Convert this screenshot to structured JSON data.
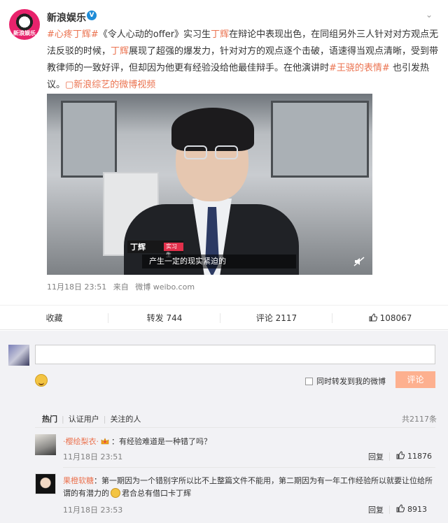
{
  "post": {
    "author": "新浪娱乐",
    "verified_mark": "V",
    "avatar_label": "新浪娱乐",
    "more_symbol": "⌄",
    "text_segments": [
      {
        "t": "#心疼丁辉#",
        "link": true
      },
      {
        "t": "《令人心动的offer》实习生",
        "link": false
      },
      {
        "t": "丁辉",
        "link": true
      },
      {
        "t": "在辩论中表现出色，在同组另外三人针对对方观点无法反驳的时候，",
        "link": false
      },
      {
        "t": "丁辉",
        "link": true
      },
      {
        "t": "展现了超强的爆发力，针对对方的观点逐个击破，语速得当观点清晰，受到带教律师的一致好评，但却因为他更有经验没给他最佳辩手。在他演讲时",
        "link": false
      },
      {
        "t": "#王骁的表情#",
        "link": true
      },
      {
        "t": " 也引发热议。",
        "link": false
      },
      {
        "t": "▢新浪综艺的微博视频",
        "link": true
      }
    ],
    "video": {
      "name_caption": "丁辉",
      "role_caption": "实习生",
      "subtitle": "产生一定的现实紧迫的"
    },
    "meta": {
      "time": "11月18日 23:51",
      "source_prefix": "来自",
      "source": "微博 weibo.com"
    }
  },
  "actions": {
    "favorite": "收藏",
    "repost": "转发 744",
    "comment": "评论 2117",
    "like": "108067"
  },
  "compose": {
    "input_placeholder": "",
    "forward_label": "同时转发到我的微博",
    "submit_label": "评论"
  },
  "comment_tabs": {
    "items": [
      "热门",
      "认证用户",
      "关注的人"
    ],
    "total": "共2117条"
  },
  "comments": [
    {
      "user": "·樱绘梨衣·",
      "text": "：有经验难道是一种错了吗？",
      "time": "11月18日 23:51",
      "reply": "回复",
      "likes": "11876"
    },
    {
      "user": "果橙软糖",
      "text_a": "：第一期因为一个错别字所以比不上整篇文件不能用，第二期因为有一年工作经验所以就要让位给所谓的有潜力的",
      "text_b": "君合总有借口卡丁辉",
      "time": "11月18日 23:53",
      "reply": "回复",
      "likes": "8913"
    }
  ],
  "colors": {
    "link": "#eb7350",
    "submit": "#fdb08f",
    "verified": "#1e8cd7"
  }
}
